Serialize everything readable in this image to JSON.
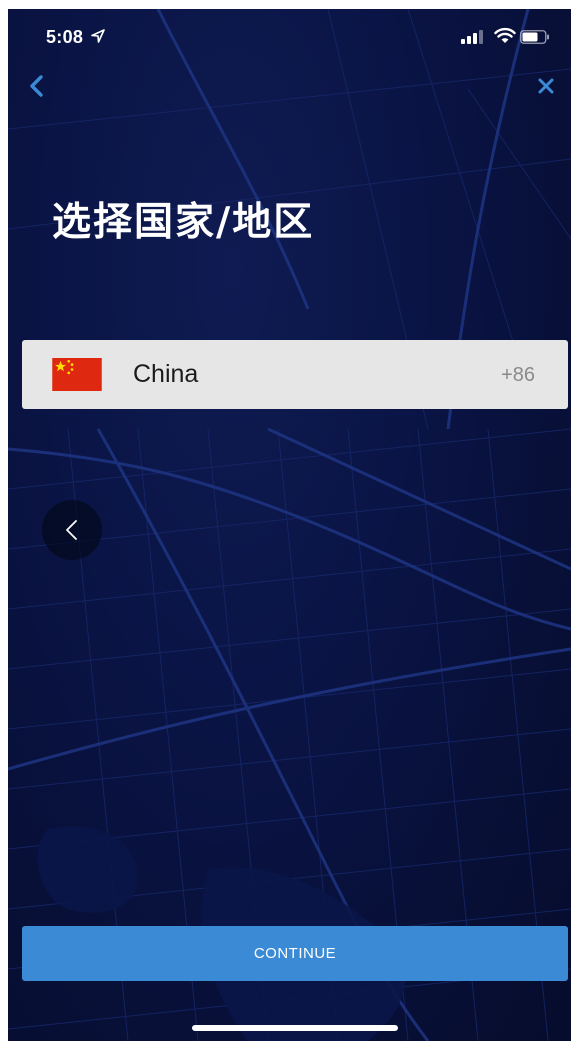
{
  "status_bar": {
    "time": "5:08",
    "icons": [
      "location-arrow-icon",
      "signal-icon",
      "wifi-icon",
      "battery-icon"
    ]
  },
  "nav": {
    "back_icon": "chevron-left-icon",
    "close_icon": "close-icon"
  },
  "title": "选择国家/地区",
  "selected_country": {
    "flag": "china-flag-icon",
    "name": "China",
    "dial_code": "+86"
  },
  "floating_back_icon": "chevron-left-icon",
  "continue_label": "CONTINUE",
  "colors": {
    "background": "#0a1445",
    "map_roads": "#1d3380",
    "accent": "#3b8ad5",
    "nav_icon": "#3b8ad5",
    "row_background": "#e6e6e6",
    "flag_red": "#de2910",
    "flag_star": "#ffde00"
  }
}
